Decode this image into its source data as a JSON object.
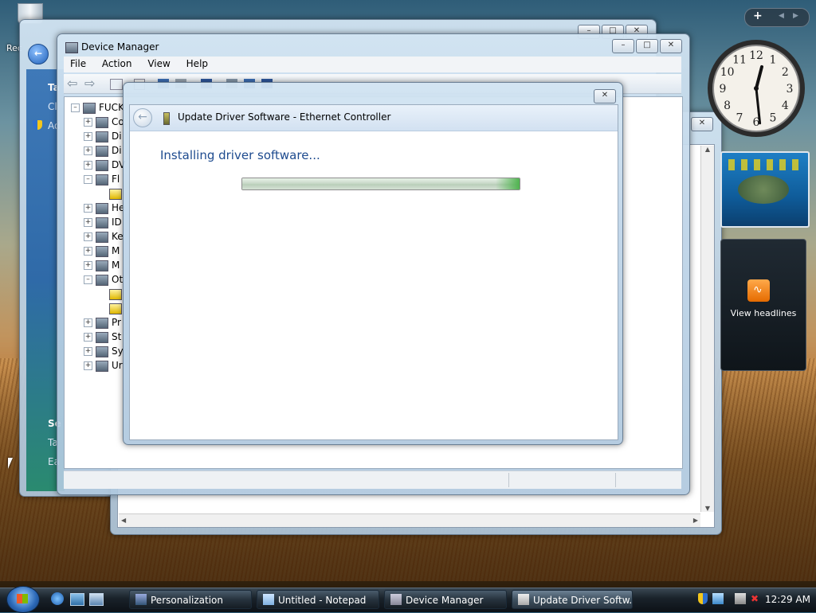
{
  "desktop": {
    "recycle_bin_label": "Rec"
  },
  "back_window": {
    "sidebar_items": [
      "Ta",
      "Cl",
      "Ad"
    ],
    "sidebar_bottom": [
      "Se",
      "Ta",
      "Ea"
    ]
  },
  "device_manager": {
    "title": "Device Manager",
    "menu": [
      "File",
      "Action",
      "View",
      "Help"
    ],
    "tree_root": "FUCK",
    "tree_items": [
      {
        "label": "Co",
        "expanded": false
      },
      {
        "label": "Di",
        "expanded": false
      },
      {
        "label": "Di",
        "expanded": false
      },
      {
        "label": "DV",
        "expanded": false
      },
      {
        "label": "Fl",
        "expanded": true
      },
      {
        "label": "",
        "expanded": null
      },
      {
        "label": "He",
        "expanded": false
      },
      {
        "label": "ID",
        "expanded": false
      },
      {
        "label": "Ke",
        "expanded": false
      },
      {
        "label": "M",
        "expanded": false
      },
      {
        "label": "M",
        "expanded": false
      },
      {
        "label": "Ot",
        "expanded": true
      },
      {
        "label": "",
        "expanded": null
      },
      {
        "label": "",
        "expanded": null
      },
      {
        "label": "Pr",
        "expanded": false
      },
      {
        "label": "St",
        "expanded": false
      },
      {
        "label": "Sy",
        "expanded": false
      },
      {
        "label": "Ur",
        "expanded": false
      }
    ]
  },
  "update_driver": {
    "title": "Update Driver Software - Ethernet Controller",
    "status": "Installing driver software...",
    "progress": 1.0
  },
  "gadgets": {
    "add_label": "+",
    "clock": {
      "hour": 12,
      "minute": 29,
      "numerals": [
        "12",
        "1",
        "2",
        "3",
        "4",
        "5",
        "6",
        "7",
        "8",
        "9",
        "10",
        "11"
      ]
    },
    "feed_label": "View headlines"
  },
  "taskbar": {
    "buttons": [
      {
        "label": "Personalization",
        "active": false
      },
      {
        "label": "Untitled - Notepad",
        "active": false
      },
      {
        "label": "Device Manager",
        "active": false
      },
      {
        "label": "Update Driver Softw...",
        "active": true
      }
    ],
    "clock": "12:29 AM"
  },
  "colors": {
    "accent": "#1e4b8f",
    "progress_green": "#4fb34f",
    "taskbar": "#1a232b"
  }
}
